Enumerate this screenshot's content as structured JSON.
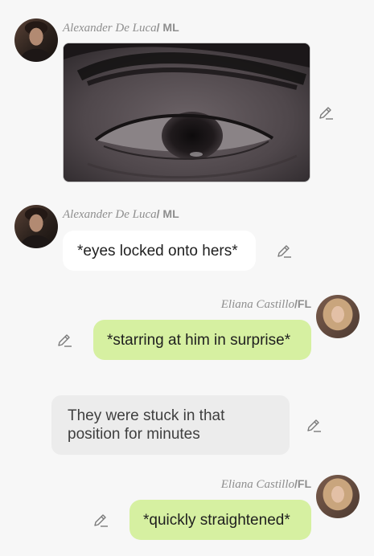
{
  "messages": [
    {
      "sender": "Alexander De Luca",
      "role": "ML",
      "kind": "image",
      "image_alt": "close-up of a dark eye",
      "avatar_icon": "ml-avatar"
    },
    {
      "sender": "Alexander De Luca",
      "role": "ML",
      "kind": "text",
      "text": "*eyes locked onto hers*",
      "avatar_icon": "ml-avatar"
    },
    {
      "sender": "Eliana Castillo",
      "role": "FL",
      "kind": "text",
      "text": "*starring at him in surprise*",
      "avatar_icon": "fl-avatar"
    },
    {
      "kind": "narration",
      "line1": "They were stuck in that",
      "line2": "position for minutes"
    },
    {
      "sender": "Eliana Castillo",
      "role": "FL",
      "kind": "text",
      "text": "*quickly straightened*",
      "avatar_icon": "fl-avatar"
    }
  ],
  "separator": "/",
  "icons": {
    "edit": "pencil-icon"
  },
  "colors": {
    "background": "#f7f7f7",
    "ml_bubble": "#ffffff",
    "fl_bubble": "#d6f0a1",
    "narration_bubble": "#ececec",
    "name_text": "#8e8e8e"
  }
}
